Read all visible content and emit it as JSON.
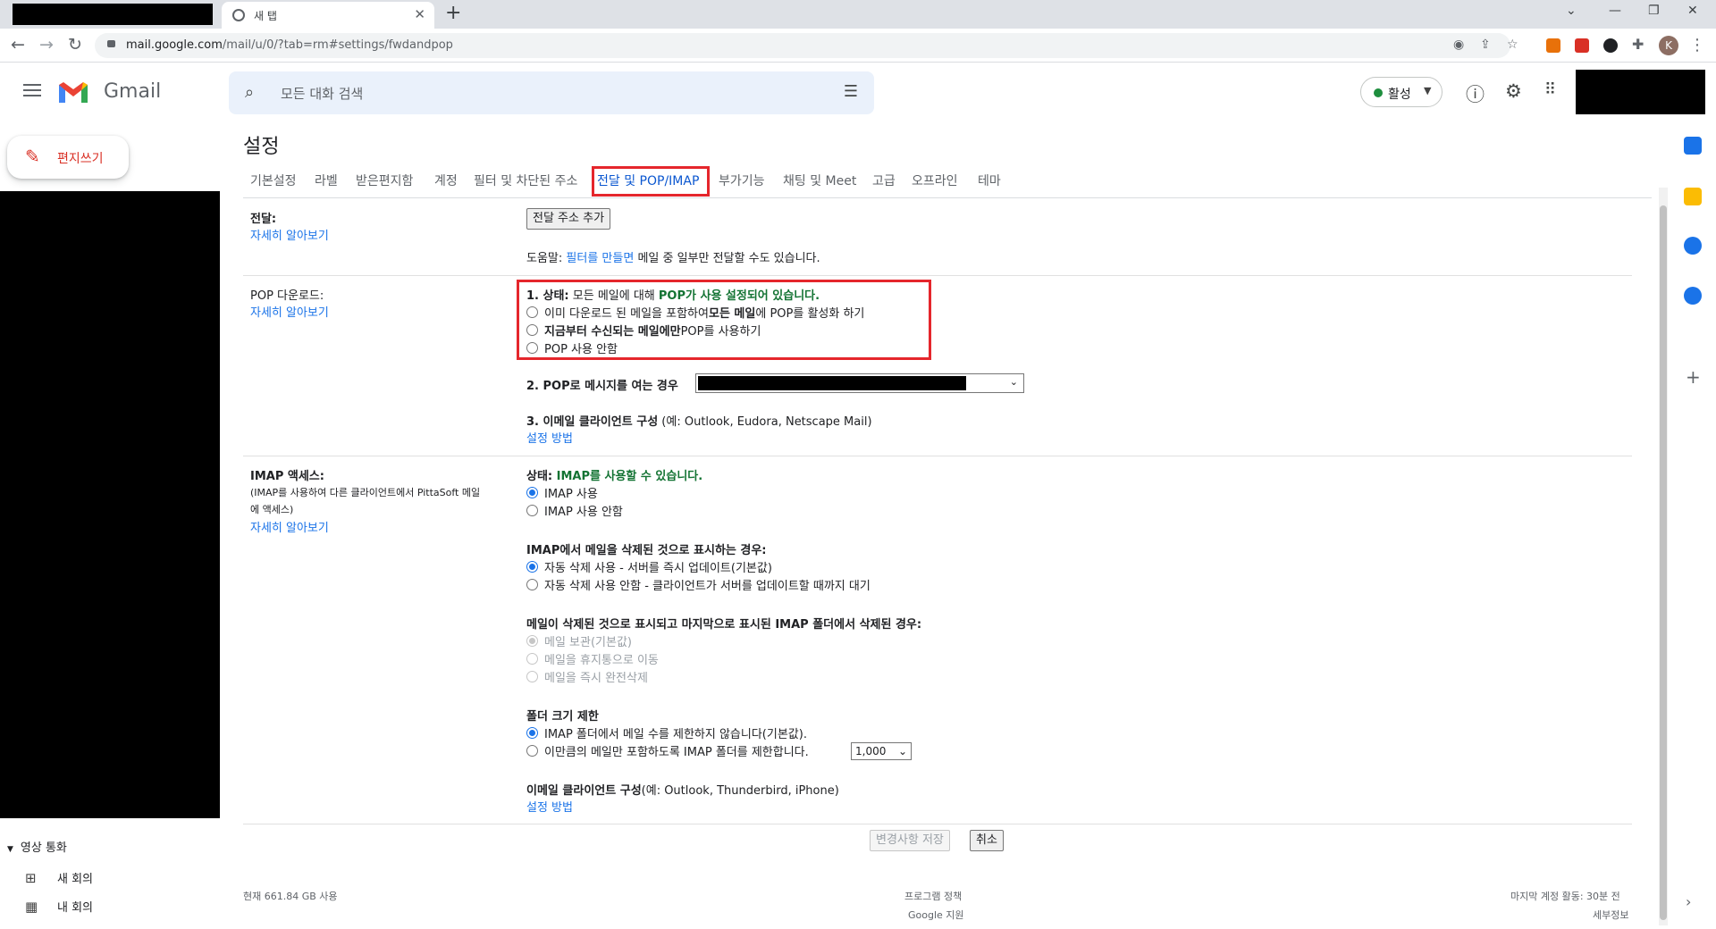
{
  "browser": {
    "tab_title": "새 탭",
    "url_host": "mail.google.com",
    "url_path": "/mail/u/0/?tab=rm#settings/fwdandpop",
    "profile_initial": "K"
  },
  "header": {
    "app_name": "Gmail",
    "search_placeholder": "모든 대화 검색",
    "status_label": "활성",
    "status_color": "#1e8e3e"
  },
  "sidebar": {
    "compose_label": "편지쓰기",
    "meet_header": "영상 통화",
    "meet_items": [
      {
        "label": "새 회의",
        "icon": "video-add-icon"
      },
      {
        "label": "내 회의",
        "icon": "calendar-icon"
      }
    ]
  },
  "settings": {
    "title": "설정",
    "tabs": [
      "기본설정",
      "라벨",
      "받은편지함",
      "계정",
      "필터 및 차단된 주소",
      "전달 및 POP/IMAP",
      "부가기능",
      "채팅 및 Meet",
      "고급",
      "오프라인",
      "테마"
    ],
    "active_tab": "전달 및 POP/IMAP",
    "forwarding": {
      "label": "전달:",
      "learn_more": "자세히 알아보기",
      "add_button": "전달 주소 추가",
      "tip_prefix": "도움말: ",
      "tip_link": "필터를 만들면",
      "tip_suffix": " 메일 중 일부만 전달할 수도 있습니다."
    },
    "pop": {
      "label": "POP 다운로드:",
      "learn_more": "자세히 알아보기",
      "status_prefix": "1. 상태:",
      "status_text": " 모든 메일에 대해 ",
      "status_green": "POP가 사용 설정되어 있습니다.",
      "opt1_a": "이미 다운로드 된 메일을 포함하여 ",
      "opt1_b": "모든 메일",
      "opt1_c": "에 POP를 활성화 하기",
      "opt2_a": "지금부터 수신되는 메일에만",
      "opt2_b": " POP를 사용하기",
      "opt3": "POP 사용 안함",
      "when_access": "2. POP로 메시지를 여는 경우",
      "client_cfg_b": "3. 이메일 클라이언트 구성",
      "client_cfg": " (예: Outlook, Eudora, Netscape Mail)",
      "setup_link": "설정 방법"
    },
    "imap": {
      "label": "IMAP 액세스:",
      "desc1": "(IMAP를 사용하여 다른 클라이언트에서 PittaSoft 메일",
      "desc2": "에 액세스)",
      "learn_more": "자세히 알아보기",
      "status_prefix": "상태: ",
      "status_green": "IMAP를 사용할 수 있습니다.",
      "opt_on": "IMAP 사용",
      "opt_off": "IMAP 사용 안함",
      "deleted_hdr": "IMAP에서 메일을 삭제된 것으로 표시하는 경우:",
      "auto_on": "자동 삭제 사용 - 서버를 즉시 업데이트(기본값)",
      "auto_off": "자동 삭제 사용 안함 - 클라이언트가 서버를 업데이트할 때까지 대기",
      "expunge_hdr": "메일이 삭제된 것으로 표시되고 마지막으로 표시된 IMAP 폴더에서 삭제된 경우:",
      "exp1": "메일 보관(기본값)",
      "exp2": "메일을 휴지통으로 이동",
      "exp3": "메일을 즉시 완전삭제",
      "folder_hdr": "폴더 크기 제한",
      "folder_opt1": "IMAP 폴더에서 메일 수를 제한하지 않습니다(기본값).",
      "folder_opt2": "이만큼의 메일만 포함하도록 IMAP 폴더를 제한합니다.",
      "folder_limit_value": "1,000",
      "client_b": "이메일 클라이언트 구성",
      "client": "(예: Outlook, Thunderbird, iPhone)",
      "setup_link": "설정 방법"
    },
    "save_button": "변경사항 저장",
    "cancel_button": "취소"
  },
  "footer": {
    "storage": "현재 661.84 GB 사용",
    "policy": "프로그램 정책",
    "support": "Google 지원",
    "last_activity": "마지막 계정 활동: 30분 전",
    "details": "세부정보"
  },
  "colors": {
    "highlight_box": "#e5262c",
    "link": "#1a73e8",
    "status_green": "#137333"
  }
}
